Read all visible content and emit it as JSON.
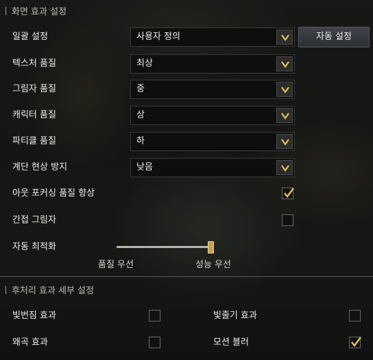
{
  "screen_effects": {
    "title": "화면 효과 설정",
    "overall": {
      "label": "일괄 설정",
      "value": "사용자 정의",
      "auto_button": "자동 설정"
    },
    "texture": {
      "label": "텍스처 품질",
      "value": "최상"
    },
    "shadow": {
      "label": "그림자 품질",
      "value": "중"
    },
    "character": {
      "label": "캐릭터 품질",
      "value": "상"
    },
    "particle": {
      "label": "파티클 품질",
      "value": "하"
    },
    "banding": {
      "label": "계단 현상 방지",
      "value": "낮음"
    },
    "out_focus": {
      "label": "아웃 포커싱 품질 향상",
      "checked": true
    },
    "indirect_shadow": {
      "label": "간접 그림자",
      "checked": false
    },
    "auto_optimize": {
      "label": "자동 최적화",
      "left_caption": "품질 우선",
      "right_caption": "성능 우선",
      "level": 1.0
    }
  },
  "post_processing": {
    "title": "후처리 효과 세부 설정",
    "bloom": {
      "label": "빛번짐 효과",
      "checked": false
    },
    "light_shaft": {
      "label": "빛줄기 효과",
      "checked": false
    },
    "distortion": {
      "label": "왜곡 효과",
      "checked": false
    },
    "motion_blur": {
      "label": "모션 블러",
      "checked": true
    }
  },
  "colors": {
    "accent": "#e6c15a",
    "checkbox_border": "#6a6a66"
  },
  "icons": {
    "dropdown": "chevron-down-icon",
    "check": "checkmark-icon"
  }
}
